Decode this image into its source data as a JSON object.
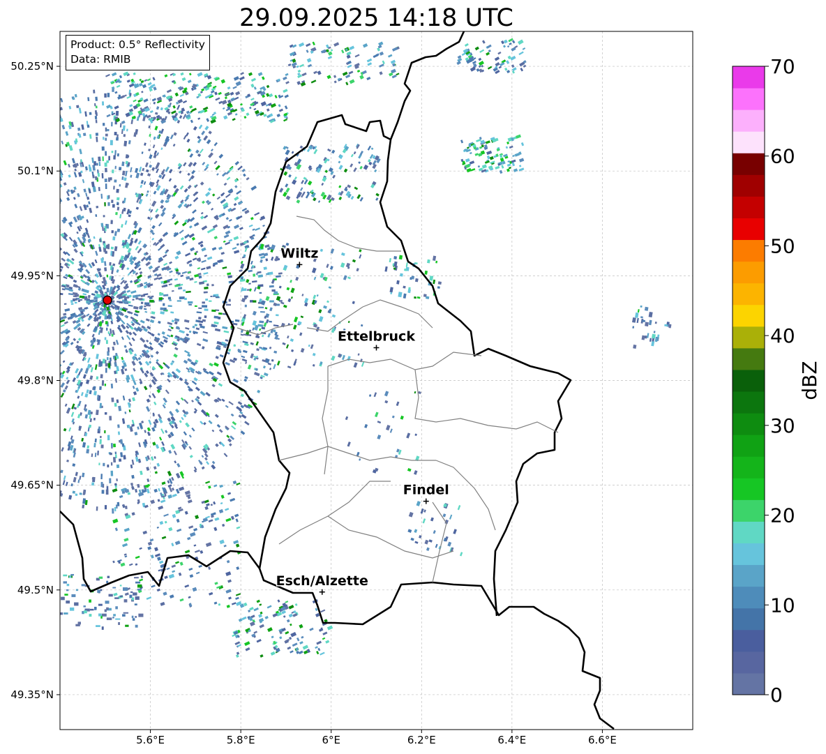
{
  "title": "29.09.2025 14:18 UTC",
  "info": {
    "product": "Product: 0.5° Reflectivity",
    "data": "Data: RMIB"
  },
  "map": {
    "lon_range": [
      5.4,
      6.8
    ],
    "lat_range": [
      49.3,
      50.3
    ],
    "x_ticks": [
      {
        "lon": 5.6,
        "label": "5.6°E"
      },
      {
        "lon": 5.8,
        "label": "5.8°E"
      },
      {
        "lon": 6.0,
        "label": "6°E"
      },
      {
        "lon": 6.2,
        "label": "6.2°E"
      },
      {
        "lon": 6.4,
        "label": "6.4°E"
      },
      {
        "lon": 6.6,
        "label": "6.6°E"
      }
    ],
    "y_ticks": [
      {
        "lat": 50.25,
        "label": "50.25°N"
      },
      {
        "lat": 50.1,
        "label": "50.1°N"
      },
      {
        "lat": 49.95,
        "label": "49.95°N"
      },
      {
        "lat": 49.8,
        "label": "49.8°N"
      },
      {
        "lat": 49.65,
        "label": "49.65°N"
      },
      {
        "lat": 49.5,
        "label": "49.5°N"
      },
      {
        "lat": 49.35,
        "label": "49.35°N"
      }
    ],
    "radar_site": {
      "lon": 5.505,
      "lat": 49.915
    },
    "cities": [
      {
        "name": "Wiltz",
        "lon": 5.93,
        "lat": 49.966
      },
      {
        "name": "Ettelbruck",
        "lon": 6.1,
        "lat": 49.847
      },
      {
        "name": "Findel",
        "lon": 6.21,
        "lat": 49.627
      },
      {
        "name": "Esch/Alzette",
        "lon": 5.98,
        "lat": 49.497
      }
    ]
  },
  "colorbar": {
    "label": "dBZ",
    "min": 0,
    "max": 70,
    "ticks": [
      0,
      10,
      20,
      30,
      40,
      50,
      60,
      70
    ],
    "tick_labels": [
      "0",
      "10",
      "20",
      "30",
      "40",
      "50",
      "60",
      "70"
    ],
    "colors": [
      "#6474a4",
      "#5866a0",
      "#4a5e9e",
      "#4474a8",
      "#4e8cba",
      "#5aa4c8",
      "#66c4dc",
      "#60d8c4",
      "#3cd46a",
      "#16c624",
      "#14b41a",
      "#10a214",
      "#0e8c10",
      "#0c760e",
      "#0a600a",
      "#457a10",
      "#aab008",
      "#fcd400",
      "#fcb400",
      "#fc9c00",
      "#fc7c00",
      "#e80000",
      "#c40000",
      "#a00000",
      "#780000",
      "#fde2fc",
      "#fcb0fc",
      "#fc72fc",
      "#ea3aea"
    ]
  }
}
